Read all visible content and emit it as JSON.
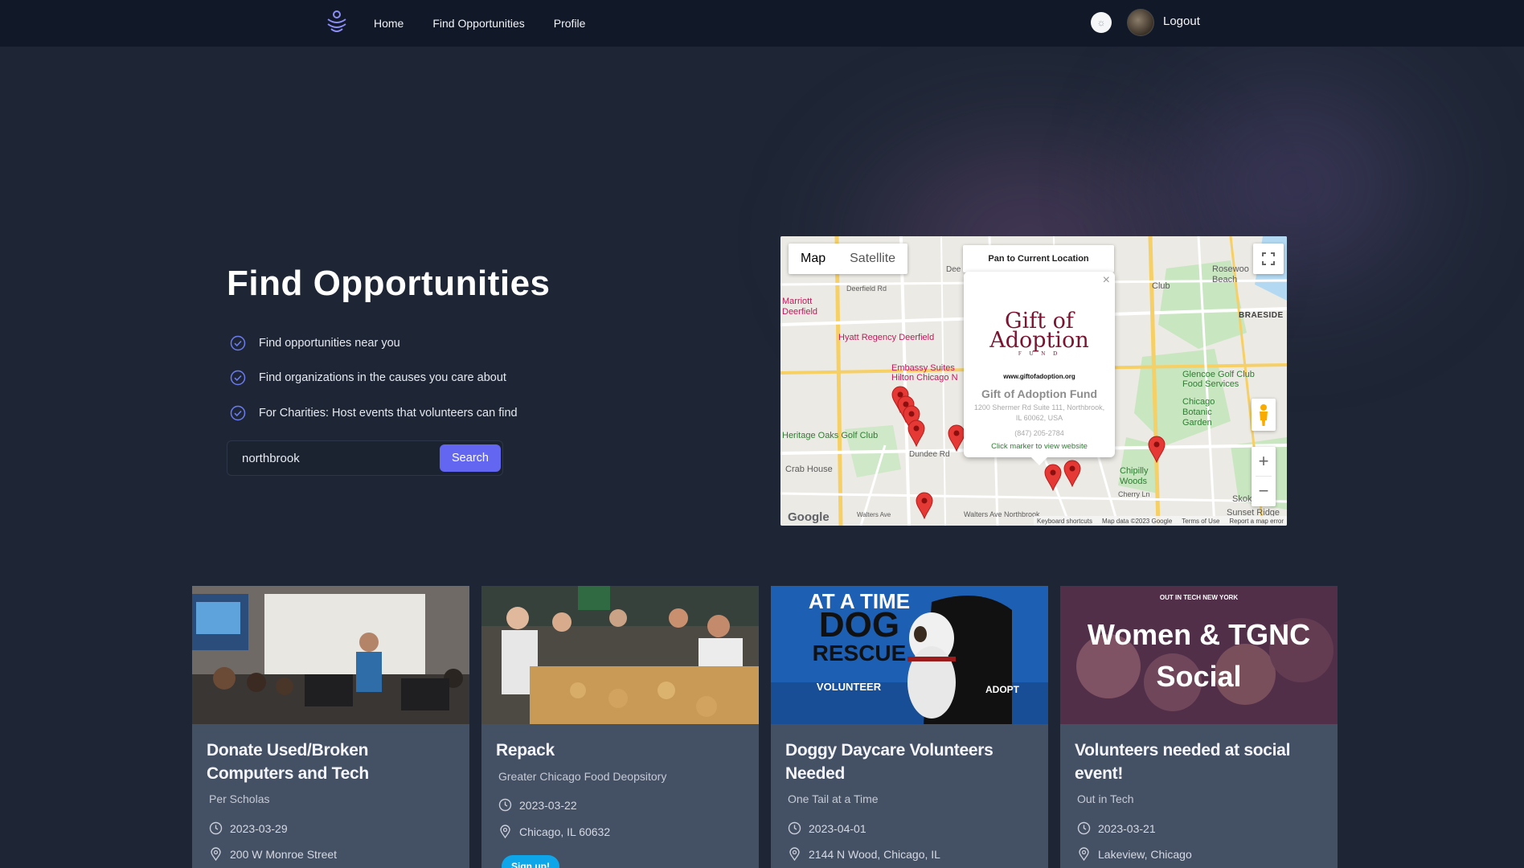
{
  "nav": {
    "links": [
      "Home",
      "Find Opportunities",
      "Profile"
    ],
    "logout": "Logout",
    "theme_icon": "sun-icon"
  },
  "hero": {
    "title": "Find Opportunities",
    "features": [
      "Find opportunities near you",
      "Find organizations in the causes you care about",
      "For Charities: Host events that volunteers can find"
    ],
    "search_value": "northbrook",
    "search_button": "Search"
  },
  "map": {
    "type_map": "Map",
    "type_satellite": "Satellite",
    "pan_button": "Pan to Current Location",
    "zoom_in": "+",
    "zoom_out": "−",
    "labels": {
      "marriott": "Marriott\nDeerfield",
      "deerfield_rd": "Deerfield Rd",
      "hyatt": "Hyatt Regency Deerfield",
      "embassy": "Embassy Suites\nHilton Chicago N",
      "heritage": "Heritage Oaks Golf Club",
      "crab": "Crab House",
      "dundee": "Dundee Rd",
      "club": "Club",
      "rosewood": "Rosewoo\nBeach",
      "braeside": "BRAESIDE",
      "glencoe": "Glencoe Golf Club\nFood Services",
      "chicago_botanic": "Chicago\nBotanic\nGarden",
      "chipilly": "Chipilly\nWoods",
      "skokie": "Skokie C",
      "sunset": "Sunset Ridge",
      "walters": "Walters Ave",
      "northbrook": "Walters Ave  Northbrook",
      "cherry": "Cherry Ln",
      "dee": "Dee"
    },
    "info_window": {
      "logo_line1": "Gift of",
      "logo_line2": "Adoption",
      "logo_line3": "F U N D",
      "url": "www.giftofadoption.org",
      "name": "Gift of Adoption Fund",
      "address": "1200 Shermer Rd Suite 111, Northbrook, IL 60062, USA",
      "phone": "(847) 205-2784",
      "link": "Click marker to view website"
    },
    "google": "Google",
    "attribution": [
      "Keyboard shortcuts",
      "Map data ©2023 Google",
      "Terms of Use",
      "Report a map error"
    ]
  },
  "cards": [
    {
      "title": "Donate Used/Broken Computers and Tech",
      "org": "Per Scholas",
      "date": "2023-03-29",
      "location": "200 W Monroe Street"
    },
    {
      "title": "Repack",
      "org": "Greater Chicago Food Deopsitory",
      "date": "2023-03-22",
      "location": "Chicago, IL 60632",
      "signup": "Sign up!"
    },
    {
      "title": "Doggy Daycare Volunteers Needed",
      "org": "One Tail at a Time",
      "date": "2023-04-01",
      "location": "2144 N Wood, Chicago, IL",
      "image_text": [
        "AT A TIME",
        "DOG",
        "RESCUE",
        "VOLUNTEER",
        "ADOPT"
      ]
    },
    {
      "title": "Volunteers needed at social event!",
      "org": "Out in Tech",
      "date": "2023-03-21",
      "location": "Lakeview, Chicago",
      "image_text": [
        "OUT IN TECH NEW YORK",
        "Women & TGNC",
        "Social"
      ]
    }
  ],
  "colors": {
    "background": "#1e2635",
    "nav": "#111827",
    "accent": "#6366f1",
    "card": "#445064",
    "marker": "#e53935"
  }
}
